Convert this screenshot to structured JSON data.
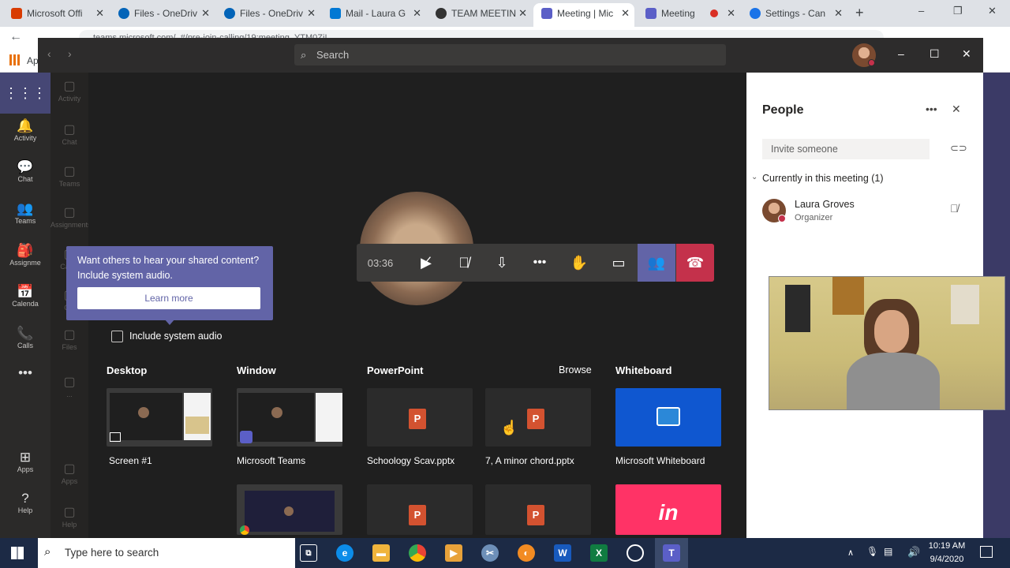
{
  "browser": {
    "tabs": [
      {
        "label": "Microsoft Offi",
        "color": "#d83b01"
      },
      {
        "label": "Files - OneDriv",
        "color": "#0364b8"
      },
      {
        "label": "Files - OneDriv",
        "color": "#0364b8"
      },
      {
        "label": "Mail - Laura G",
        "color": "#0078d4"
      },
      {
        "label": "TEAM MEETIN",
        "color": "#333333"
      },
      {
        "label": "Meeting | Mic",
        "color": "#5b5fc7"
      },
      {
        "label": "Meeting",
        "color": "#5b5fc7"
      },
      {
        "label": "Settings - Can",
        "color": "#1a73e8"
      }
    ],
    "new_tab": "+",
    "address": "teams.microsoft.com/_#/pre-join-calling/19:meeting_YTM0ZjI...",
    "bookmarks_label": "Ap",
    "window_controls": [
      "–",
      "❐",
      "✕"
    ]
  },
  "teams": {
    "search_placeholder": "Search",
    "window_controls": [
      "–",
      "☐",
      "✕"
    ],
    "rail": [
      {
        "label": "Activity",
        "icon": "bell-icon",
        "glyph": "🔔"
      },
      {
        "label": "Chat",
        "icon": "chat-icon",
        "glyph": "💬"
      },
      {
        "label": "Teams",
        "icon": "teams-icon",
        "glyph": "👥"
      },
      {
        "label": "Assignme",
        "icon": "assignments-icon",
        "glyph": "🎒"
      },
      {
        "label": "Calenda",
        "icon": "calendar-icon",
        "glyph": "📅"
      },
      {
        "label": "Calls",
        "icon": "phone-icon",
        "glyph": "📞"
      },
      {
        "label": "...",
        "icon": "more-icon",
        "glyph": "•••"
      },
      {
        "label": "Apps",
        "icon": "apps-icon",
        "glyph": "⊞"
      },
      {
        "label": "Help",
        "icon": "help-icon",
        "glyph": "?"
      }
    ],
    "rail2": [
      {
        "label": "Activity"
      },
      {
        "label": "Chat"
      },
      {
        "label": "Teams"
      },
      {
        "label": "Assignments"
      },
      {
        "label": "Calen"
      },
      {
        "label": "Cal"
      },
      {
        "label": "Files"
      },
      {
        "label": "..."
      },
      {
        "label": "Apps"
      },
      {
        "label": "Help"
      }
    ]
  },
  "call": {
    "timer": "03:36"
  },
  "tooltip": {
    "text": "Want others to hear your shared content? Include system audio.",
    "button": "Learn more"
  },
  "share": {
    "include_audio_label": "Include system audio",
    "include_audio_checked": false,
    "sections": {
      "desktop": "Desktop",
      "window": "Window",
      "powerpoint": "PowerPoint",
      "browse": "Browse",
      "whiteboard": "Whiteboard"
    },
    "items": {
      "screen1": "Screen #1",
      "teams_window": "Microsoft Teams",
      "ppt1": "Schoology Scav.pptx",
      "ppt2": "7, A minor chord.pptx",
      "whiteboard": "Microsoft Whiteboard",
      "invision": "in"
    }
  },
  "people": {
    "title": "People",
    "invite_placeholder": "Invite someone",
    "section": "Currently in this meeting (1)",
    "participant": {
      "name": "Laura Groves",
      "role": "Organizer"
    }
  },
  "taskbar": {
    "search_placeholder": "Type here to search",
    "time": "10:19 AM",
    "date": "9/4/2020"
  },
  "colors": {
    "teams_purple": "#6264a7",
    "hangup": "#c4314b",
    "whiteboard_blue": "#0f57d0",
    "invision_pink": "#ff3366"
  }
}
